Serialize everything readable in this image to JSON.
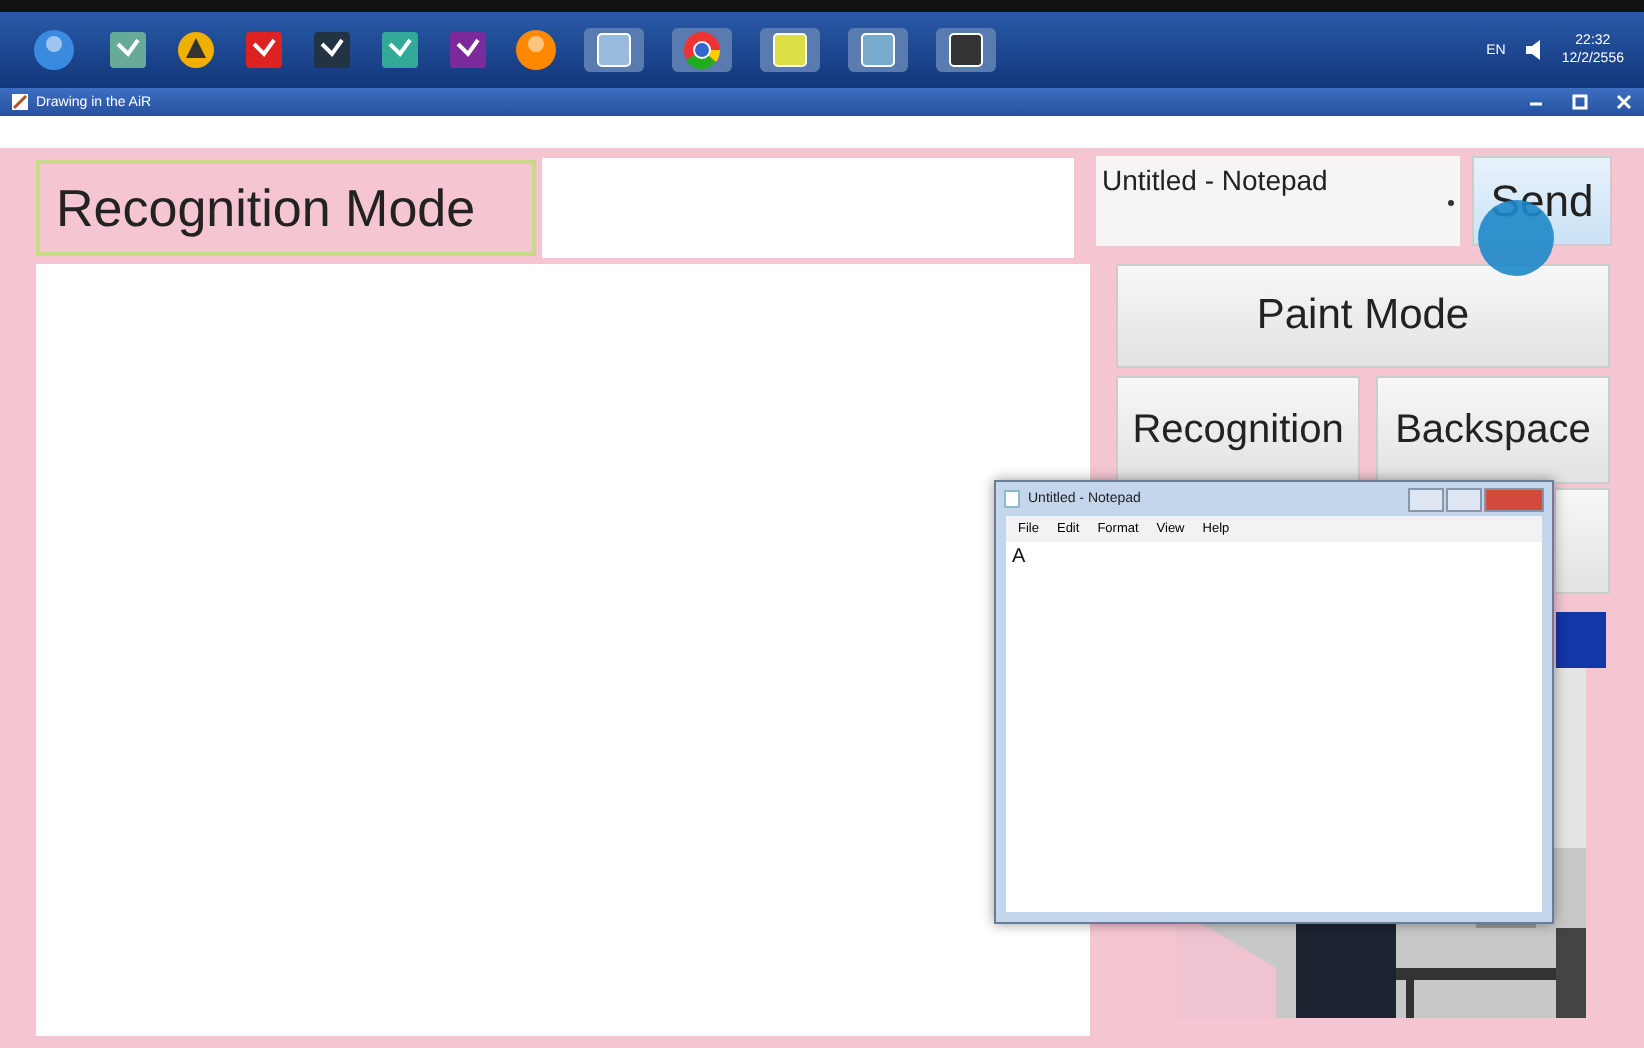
{
  "taskbar": {
    "language": "EN",
    "time": "22:32",
    "date": "12/2/2556"
  },
  "window": {
    "title": "Drawing in the AiR"
  },
  "mode_label": "Recognition Mode",
  "target_dropdown": {
    "value": "Untitled - Notepad"
  },
  "send_button": "Send",
  "paint_mode_button": "Paint Mode",
  "recognition_button": "Recognition",
  "backspace_button": "Backspace",
  "notepad": {
    "title": "Untitled - Notepad",
    "menu": [
      "File",
      "Edit",
      "Format",
      "View",
      "Help"
    ],
    "content": "A"
  }
}
